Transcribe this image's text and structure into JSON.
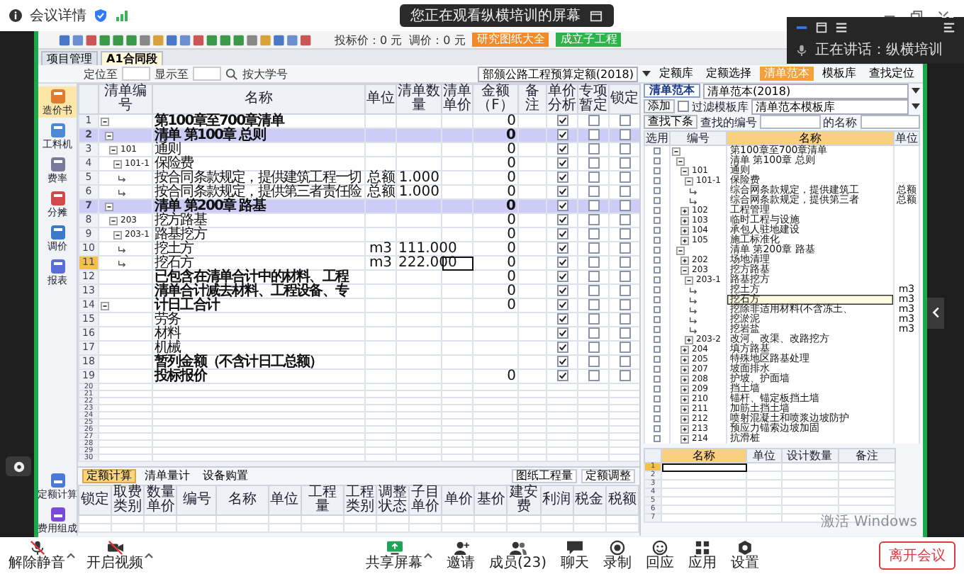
{
  "meeting": {
    "details_label": "会议详情",
    "title": "您正在观看纵横培训的屏幕",
    "speaker": "正在讲话：纵横培训",
    "windows_notice": "激活 Windows",
    "controls": [
      {
        "label": "解除静音",
        "kind": "mic"
      },
      {
        "label": "开启视频",
        "kind": "video"
      },
      {
        "label": "共享屏幕",
        "kind": "share"
      },
      {
        "label": "邀请",
        "kind": "invite"
      },
      {
        "label": "成员(23)",
        "kind": "members"
      },
      {
        "label": "聊天",
        "kind": "chat"
      },
      {
        "label": "录制",
        "kind": "record"
      },
      {
        "label": "回应",
        "kind": "react"
      },
      {
        "label": "应用",
        "kind": "apps"
      },
      {
        "label": "设置",
        "kind": "settings"
      }
    ],
    "leave_button": "离开会议"
  },
  "app": {
    "toolbar": {
      "bid_price": "投标价：0 元",
      "adjust_price": "调价：0 元",
      "orange_button": "研究图纸大全",
      "green_button": "成立子工程"
    },
    "tabs": [
      {
        "label": "项目管理",
        "selected": false
      },
      {
        "label": "A1合同段",
        "selected": true
      }
    ],
    "subtoolbar": {
      "locate": "定位至",
      "display": "显示至",
      "search": "按大学号",
      "quota_select": "部颁公路工程预算定额(2018)"
    },
    "library_buttons": [
      {
        "label": "定额库",
        "selected": false
      },
      {
        "label": "定额选择",
        "selected": false
      },
      {
        "label": "清单范本",
        "selected": true
      },
      {
        "label": "模板库",
        "selected": false
      },
      {
        "label": "查找定位",
        "selected": false
      }
    ],
    "nav": [
      {
        "label": "造价书",
        "selected": true
      },
      {
        "label": "工料机",
        "selected": false
      },
      {
        "label": "费率",
        "selected": false
      },
      {
        "label": "分摊",
        "selected": false
      },
      {
        "label": "调价",
        "selected": false
      },
      {
        "label": "报表",
        "selected": false
      }
    ],
    "nav_bottom": [
      {
        "label": "定额计算",
        "selected": false
      },
      {
        "label": "费用组成",
        "selected": false
      }
    ],
    "main_table": {
      "columns": [
        "清单编号",
        "名称",
        "单位",
        "清单数量",
        "清单单价",
        "金额（F）",
        "备注",
        "单价分析",
        "专项暂定",
        "锁定"
      ],
      "rows": [
        {
          "number": "1",
          "name": "第100章至700章清单",
          "amount": "0",
          "kind": "total",
          "expanded": true,
          "selected": false,
          "price_analysis": true,
          "provisional": false,
          "locked": false,
          "children": [
            {
              "number": "2",
              "name": "清单 第100章 总则",
              "amount": "0",
              "kind": "chapter",
              "expanded": true,
              "selected": false,
              "price_analysis": true,
              "provisional": false,
              "locked": false,
              "children": [
                {
                  "number": "3",
                  "code": "101",
                  "name": "通则",
                  "amount": "0",
                  "kind": "item",
                  "expanded": true,
                  "selected": false,
                  "price_analysis": true,
                  "provisional": false,
                  "locked": false,
                  "children": [
                    {
                      "number": "4",
                      "code": "101-1",
                      "name": "保险费",
                      "amount": "0",
                      "kind": "item",
                      "expanded": true,
                      "selected": false,
                      "price_analysis": true,
                      "provisional": false,
                      "locked": false,
                      "children": [
                        {
                          "number": "5",
                          "name": "按合同条款规定，提供建筑工程一切",
                          "unit": "总额",
                          "quantity": "1.000",
                          "amount": "0",
                          "kind": "leaf",
                          "selected": false,
                          "price_analysis": true,
                          "provisional": false,
                          "locked": false
                        },
                        {
                          "number": "6",
                          "name": "按合同条款规定，提供第三者责任险",
                          "unit": "总额",
                          "quantity": "1.000",
                          "amount": "0",
                          "kind": "leaf",
                          "selected": false,
                          "price_analysis": true,
                          "provisional": false,
                          "locked": false
                        }
                      ]
                    }
                  ]
                }
              ]
            },
            {
              "number": "7",
              "name": "清单 第200章 路基",
              "amount": "0",
              "kind": "chapter",
              "expanded": true,
              "selected": false,
              "price_analysis": true,
              "provisional": false,
              "locked": false,
              "children": [
                {
                  "number": "8",
                  "code": "203",
                  "name": "挖方路基",
                  "amount": "0",
                  "kind": "item",
                  "expanded": true,
                  "selected": false,
                  "price_analysis": true,
                  "provisional": false,
                  "locked": false,
                  "children": [
                    {
                      "number": "9",
                      "code": "203-1",
                      "name": "路基挖方",
                      "amount": "0",
                      "kind": "item",
                      "expanded": true,
                      "selected": false,
                      "price_analysis": true,
                      "provisional": false,
                      "locked": false,
                      "children": [
                        {
                          "number": "10",
                          "name": "挖土方",
                          "unit": "m3",
                          "quantity": "111.000",
                          "amount": "0",
                          "kind": "leaf",
                          "selected": false,
                          "price_analysis": true,
                          "provisional": false,
                          "locked": false
                        },
                        {
                          "number": "11",
                          "name": "挖石方",
                          "unit": "m3",
                          "quantity": "222.000",
                          "amount": "0",
                          "kind": "leaf",
                          "selected": true,
                          "price_analysis": true,
                          "provisional": false,
                          "locked": false
                        }
                      ]
                    }
                  ]
                }
              ]
            }
          ]
        },
        {
          "number": "12",
          "name": "已包含在清单合计中的材料、工程",
          "amount": "0",
          "kind": "total",
          "selected": false,
          "price_analysis": true,
          "provisional": false,
          "locked": false
        },
        {
          "number": "13",
          "name": "清单合计减去材料、工程设备、专",
          "amount": "0",
          "kind": "total",
          "selected": false,
          "price_analysis": true,
          "provisional": false,
          "locked": false
        },
        {
          "number": "14",
          "name": "计日工合计",
          "amount": "0",
          "kind": "total",
          "expanded": true,
          "selected": false,
          "price_analysis": true,
          "provisional": false,
          "locked": false,
          "children": [
            {
              "number": "15",
              "name": "劳务",
              "kind": "item",
              "selected": false,
              "price_analysis": true,
              "provisional": false,
              "locked": false
            },
            {
              "number": "16",
              "name": "材料",
              "kind": "item",
              "selected": false,
              "price_analysis": true,
              "provisional": false,
              "locked": false
            },
            {
              "number": "17",
              "name": "机械",
              "kind": "item",
              "selected": false,
              "price_analysis": true,
              "provisional": false,
              "locked": false
            }
          ]
        },
        {
          "number": "18",
          "name": "暂列金额（不含计日工总额）",
          "kind": "total",
          "selected": false,
          "price_analysis": true,
          "provisional": false,
          "locked": false
        },
        {
          "number": "19",
          "name": "投标报价",
          "amount": "0",
          "kind": "total",
          "selected": false,
          "price_analysis": true,
          "provisional": false,
          "locked": false
        }
      ],
      "empty_rows": [
        "20",
        "21",
        "22",
        "23",
        "24",
        "25",
        "26",
        "27",
        "28",
        "29",
        "30"
      ]
    },
    "lower_panel": {
      "tabs": [
        {
          "label": "定额计算",
          "selected": true
        },
        {
          "label": "清单量计",
          "selected": false
        },
        {
          "label": "设备购置",
          "selected": false
        }
      ],
      "buttons": [
        "图纸工程量",
        "定额调整"
      ],
      "columns": [
        "锁定",
        "取费类别",
        "数量单价",
        "编号",
        "名称",
        "单位",
        "工程量",
        "工程类别",
        "调整状态",
        "子目单价",
        "单价",
        "基价",
        "建安费",
        "利润",
        "税金",
        "税额"
      ]
    },
    "library": {
      "tab": "清单范本",
      "template": "清单范本(2018)",
      "add_button": "添加",
      "filter": {
        "label": "过滤模板库",
        "checked": false
      },
      "filter_select": "清单范本模板库",
      "find_next": "查找下条",
      "find_code_label": "查找的编号",
      "find_name_label": "的名称",
      "columns": [
        "选用",
        "编号",
        "名称",
        "单位"
      ],
      "tree": [
        {
          "name": "第100章至700章清单",
          "expanded": true,
          "selected": false,
          "chosen": false,
          "children": [
            {
              "name": "清单 第100章 总则",
              "expanded": true,
              "selected": false,
              "chosen": false,
              "children": [
                {
                  "code": "101",
                  "name": "通则",
                  "expanded": true,
                  "selected": false,
                  "chosen": false,
                  "children": [
                    {
                      "code": "101-1",
                      "name": "保险费",
                      "expanded": true,
                      "selected": false,
                      "chosen": false,
                      "children": [
                        {
                          "name": "综合网条款规定，提供建筑工",
                          "unit": "总额",
                          "selected": false,
                          "chosen": false
                        },
                        {
                          "name": "综合网条款规定，提供第三者",
                          "unit": "总额",
                          "selected": false,
                          "chosen": false
                        }
                      ]
                    }
                  ]
                },
                {
                  "code": "102",
                  "name": "工程管理",
                  "expanded": false,
                  "selected": false,
                  "chosen": false
                },
                {
                  "code": "103",
                  "name": "临时工程与设施",
                  "expanded": false,
                  "selected": false,
                  "chosen": false
                },
                {
                  "code": "104",
                  "name": "承包人驻地建设",
                  "expanded": false,
                  "selected": false,
                  "chosen": false
                },
                {
                  "code": "105",
                  "name": "施工标准化",
                  "expanded": false,
                  "selected": false,
                  "chosen": false
                }
              ]
            },
            {
              "name": "清单 第200章 路基",
              "expanded": true,
              "selected": false,
              "chosen": false,
              "children": [
                {
                  "code": "202",
                  "name": "场地清理",
                  "expanded": false,
                  "selected": false,
                  "chosen": false
                },
                {
                  "code": "203",
                  "name": "挖方路基",
                  "expanded": true,
                  "selected": false,
                  "chosen": false,
                  "children": [
                    {
                      "code": "203-1",
                      "name": "路基挖方",
                      "expanded": true,
                      "selected": false,
                      "chosen": false,
                      "children": [
                        {
                          "name": "挖土方",
                          "unit": "m3",
                          "selected": false,
                          "chosen": false
                        },
                        {
                          "name": "挖石方",
                          "unit": "m3",
                          "selected": true,
                          "chosen": false
                        },
                        {
                          "name": "挖除非适用材料(不含冻土、",
                          "unit": "m3",
                          "selected": false,
                          "chosen": false
                        },
                        {
                          "name": "挖淤泥",
                          "unit": "m3",
                          "selected": false,
                          "chosen": false
                        },
                        {
                          "name": "挖岩盐",
                          "unit": "m3",
                          "selected": false,
                          "chosen": false
                        }
                      ]
                    },
                    {
                      "code": "203-2",
                      "name": "改河、改渠、改路挖方",
                      "expanded": false,
                      "selected": false,
                      "chosen": false
                    }
                  ]
                },
                {
                  "code": "204",
                  "name": "填方路基",
                  "expanded": false,
                  "selected": false,
                  "chosen": false
                },
                {
                  "code": "205",
                  "name": "特殊地区路基处理",
                  "expanded": false,
                  "selected": false,
                  "chosen": false
                },
                {
                  "code": "207",
                  "name": "坡面排水",
                  "expanded": false,
                  "selected": false,
                  "chosen": false
                },
                {
                  "code": "208",
                  "name": "护坡、护面墙",
                  "expanded": false,
                  "selected": false,
                  "chosen": false
                },
                {
                  "code": "209",
                  "name": "挡土墙",
                  "expanded": false,
                  "selected": false,
                  "chosen": false
                },
                {
                  "code": "210",
                  "name": "锚杆、锚定板挡土墙",
                  "expanded": false,
                  "selected": false,
                  "chosen": false
                },
                {
                  "code": "211",
                  "name": "加筋土挡土墙",
                  "expanded": false,
                  "selected": false,
                  "chosen": false
                },
                {
                  "code": "212",
                  "name": "喷射混凝土和喷浆边坡防护",
                  "expanded": false,
                  "selected": false,
                  "chosen": false
                },
                {
                  "code": "213",
                  "name": "预应力锚索边坡加固",
                  "expanded": false,
                  "selected": false,
                  "chosen": false
                },
                {
                  "code": "214",
                  "name": "抗滑桩",
                  "expanded": false,
                  "selected": false,
                  "chosen": false
                }
              ]
            }
          ]
        }
      ],
      "detail_columns": [
        "名称",
        "单位",
        "设计数量",
        "备注"
      ],
      "detail_rows": [
        {
          "number": "1",
          "selected": true
        },
        {
          "number": "2",
          "selected": false
        },
        {
          "number": "3",
          "selected": false
        },
        {
          "number": "4",
          "selected": false
        },
        {
          "number": "5",
          "selected": false
        },
        {
          "number": "6",
          "selected": false
        },
        {
          "number": "7",
          "selected": false
        }
      ]
    }
  }
}
